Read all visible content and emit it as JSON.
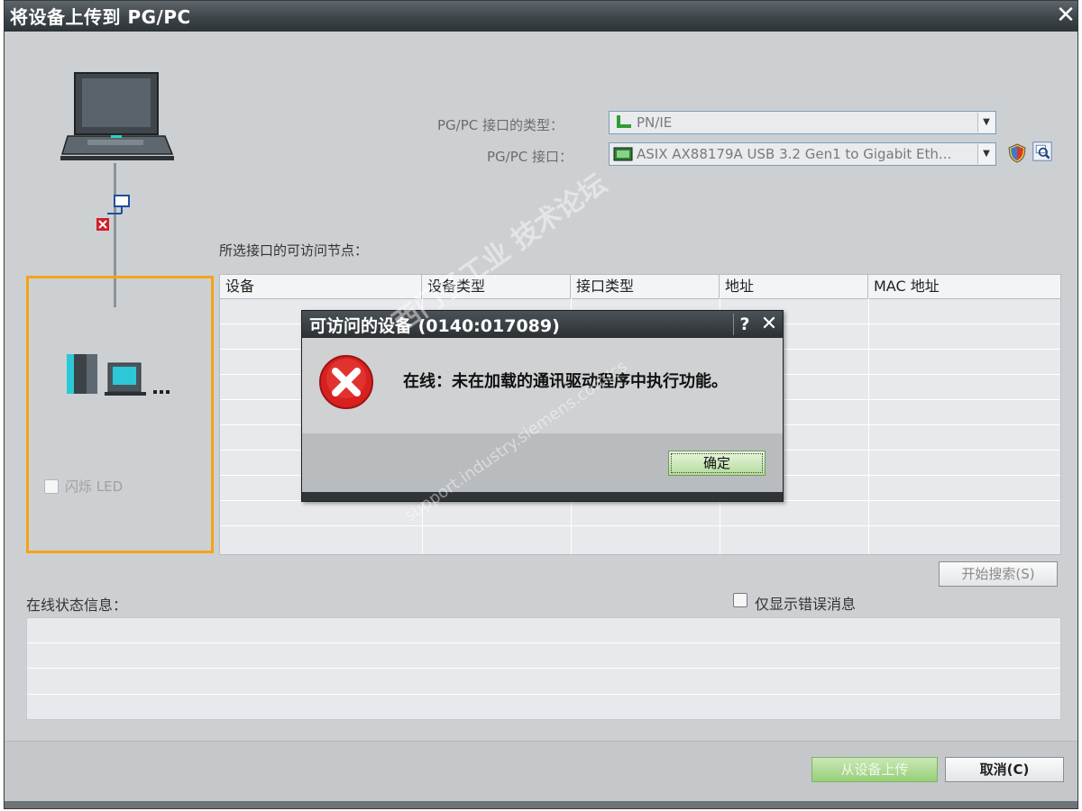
{
  "window": {
    "title": "将设备上传到 PG/PC"
  },
  "interface": {
    "type_label": "PG/PC 接口的类型：",
    "type_value": "PN/IE",
    "port_label": "PG/PC 接口：",
    "port_value": "ASIX AX88179A USB 3.2 Gen1 to Gigabit Eth..."
  },
  "left_panel": {
    "flash_led_label": "闪烁 LED"
  },
  "nodes": {
    "section_label": "所选接口的可访问节点：",
    "columns": [
      "设备",
      "设备类型",
      "接口类型",
      "地址",
      "MAC 地址"
    ]
  },
  "search_button": "开始搜索(S)",
  "status": {
    "label": "在线状态信息：",
    "errors_only_label": "仅显示错误消息"
  },
  "footer": {
    "upload_button": "从设备上传",
    "cancel_button": "取消(C)"
  },
  "dialog": {
    "title": "可访问的设备 (0140:017089)",
    "help": "?",
    "message": "在线：未在加载的通讯驱动程序中执行功能。",
    "ok_button": "确定"
  },
  "watermark": {
    "line1": "西门子工业 技术论坛",
    "line2": "support.industry.siemens.com/cs"
  },
  "colors": {
    "highlight": "#f4a316",
    "error_red": "#d8201f",
    "ok_green": "#b4dc9b"
  },
  "icons": [
    "close-icon",
    "laptop-icon",
    "network-error-icon",
    "plc-device-icon",
    "network-type-icon",
    "network-card-icon",
    "shield-icon",
    "diagnostic-icon",
    "error-icon"
  ]
}
